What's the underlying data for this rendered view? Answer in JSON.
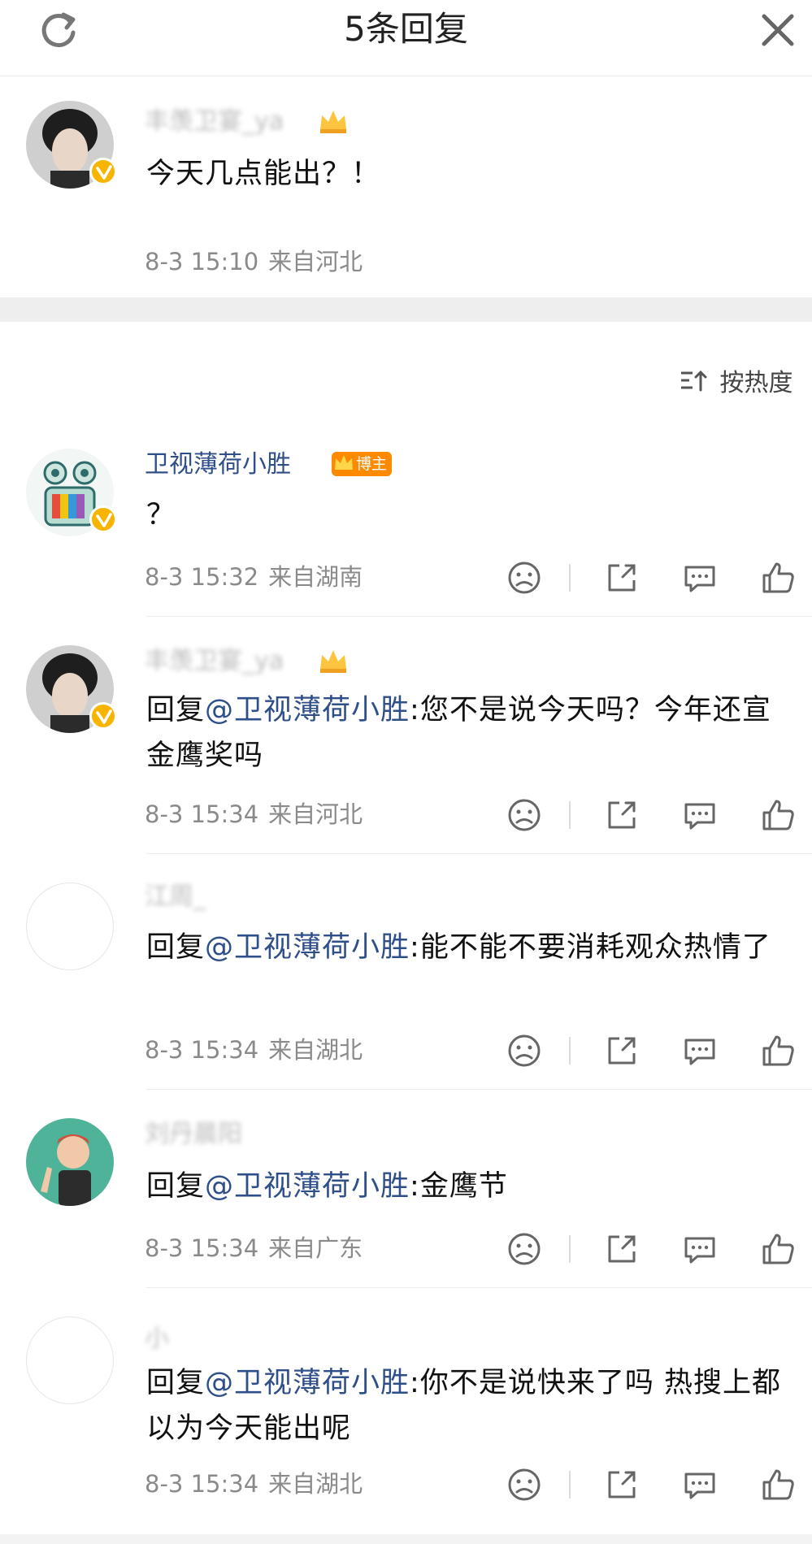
{
  "header": {
    "title": "5条回复",
    "refresh_icon": "refresh-icon",
    "close_icon": "close-icon"
  },
  "original_comment": {
    "username": "丰羡卫宴_ya",
    "content": "今天几点能出？！",
    "time": "8-3 15:10",
    "location": "来自河北"
  },
  "sort": {
    "label": "按热度",
    "icon": "sort-icon"
  },
  "replies": [
    {
      "username": "卫视薄荷小胜",
      "badge": "博主",
      "mention": "",
      "text": "？",
      "time": "8-3 15:32",
      "location": "来自湖南"
    },
    {
      "username": "丰羡卫宴_ya",
      "mention": "@卫视薄荷小胜",
      "prefix": "回复",
      "text": ":您不是说今天吗？今年还宣金鹰奖吗",
      "time": "8-3 15:34",
      "location": "来自河北"
    },
    {
      "username": "江周_",
      "mention": "@卫视薄荷小胜",
      "prefix": "回复",
      "text": ":能不能不要消耗观众热情了",
      "time": "8-3 15:34",
      "location": "来自湖北"
    },
    {
      "username": "刘丹晨阳",
      "mention": "@卫视薄荷小胜",
      "prefix": "回复",
      "text": ":金鹰节",
      "time": "8-3 15:34",
      "location": "来自广东"
    },
    {
      "username": "小",
      "mention": "@卫视薄荷小胜",
      "prefix": "回复",
      "text": ":你不是说快来了吗 热搜上都以为今天能出呢",
      "time": "8-3 15:34",
      "location": "来自湖北"
    }
  ],
  "colors": {
    "mention": "#2f4f8a",
    "meta": "#8a8a8a",
    "vip_orange": "#ff8a00",
    "verified": "#f7b500"
  }
}
